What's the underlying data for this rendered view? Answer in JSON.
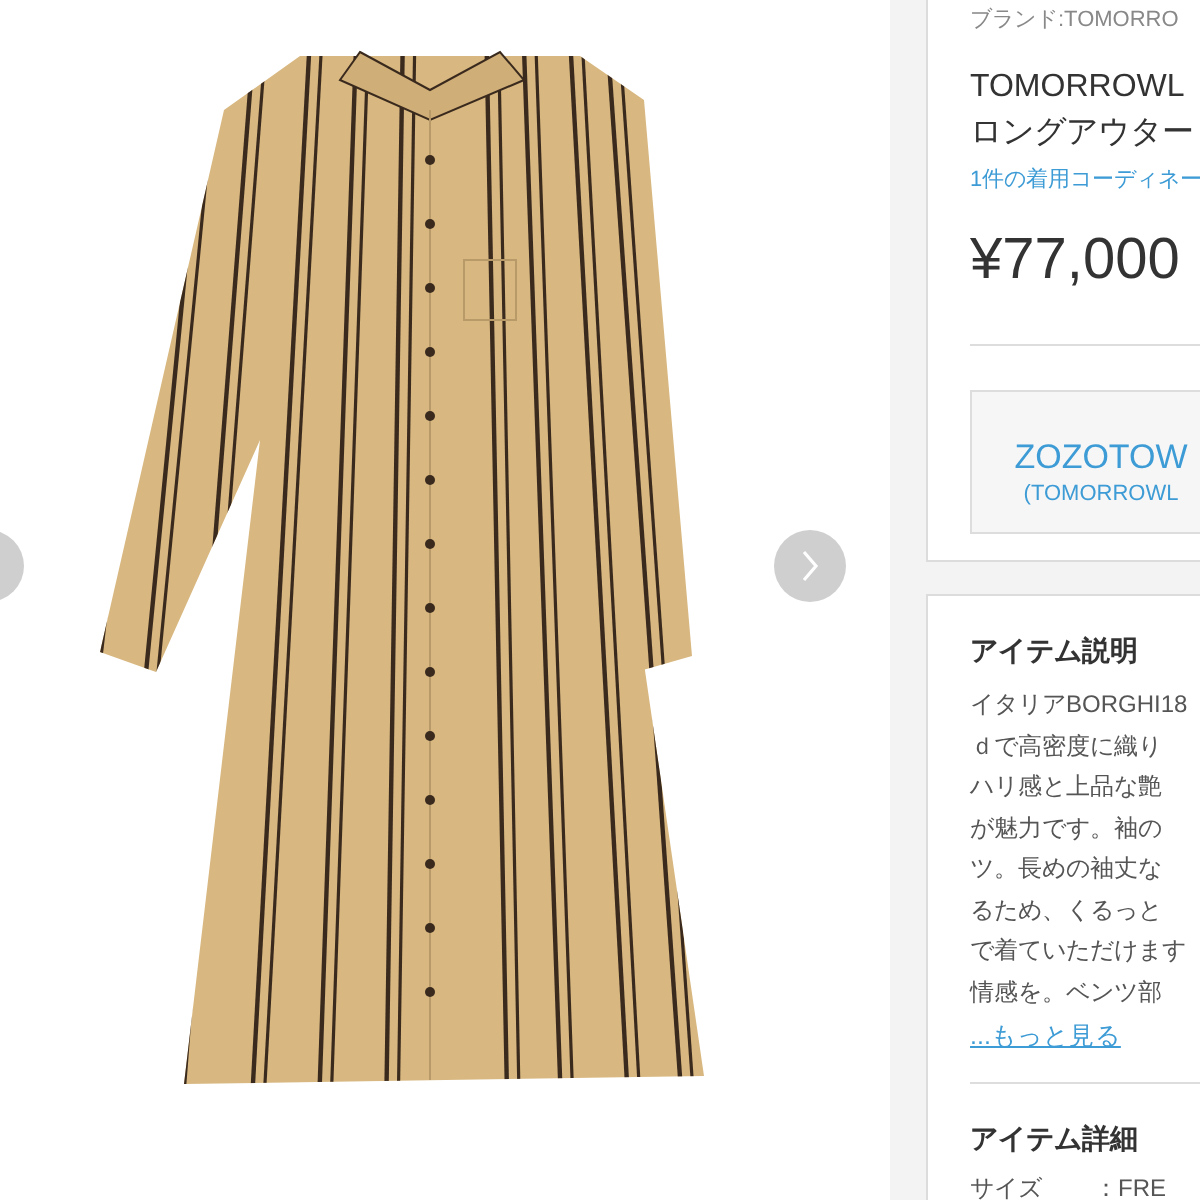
{
  "product": {
    "brand": "ブランド:TOMORRO",
    "title_lines": [
      "TOMORROWL",
      "ロングアウター"
    ],
    "coordinate_link": "1件の着用コーディネー",
    "price": "¥77,000"
  },
  "shop_button": {
    "name": "ZOZOTOW",
    "sub": "(TOMORROWL"
  },
  "description": {
    "heading": "アイテム説明",
    "lines": [
      "イタリアBORGHI18",
      "ｄで高密度に織り",
      "ハリ感と上品な艶",
      "が魅力です。袖の",
      "ツ。長めの袖丈な",
      "るため、くるっと",
      "で着ていただけます",
      "情感を。ベンツ部"
    ],
    "more_link": "...もっと見る"
  },
  "details": {
    "heading": "アイテム詳細",
    "rows": [
      {
        "label": "サイズ",
        "value": "：FRE"
      }
    ]
  }
}
